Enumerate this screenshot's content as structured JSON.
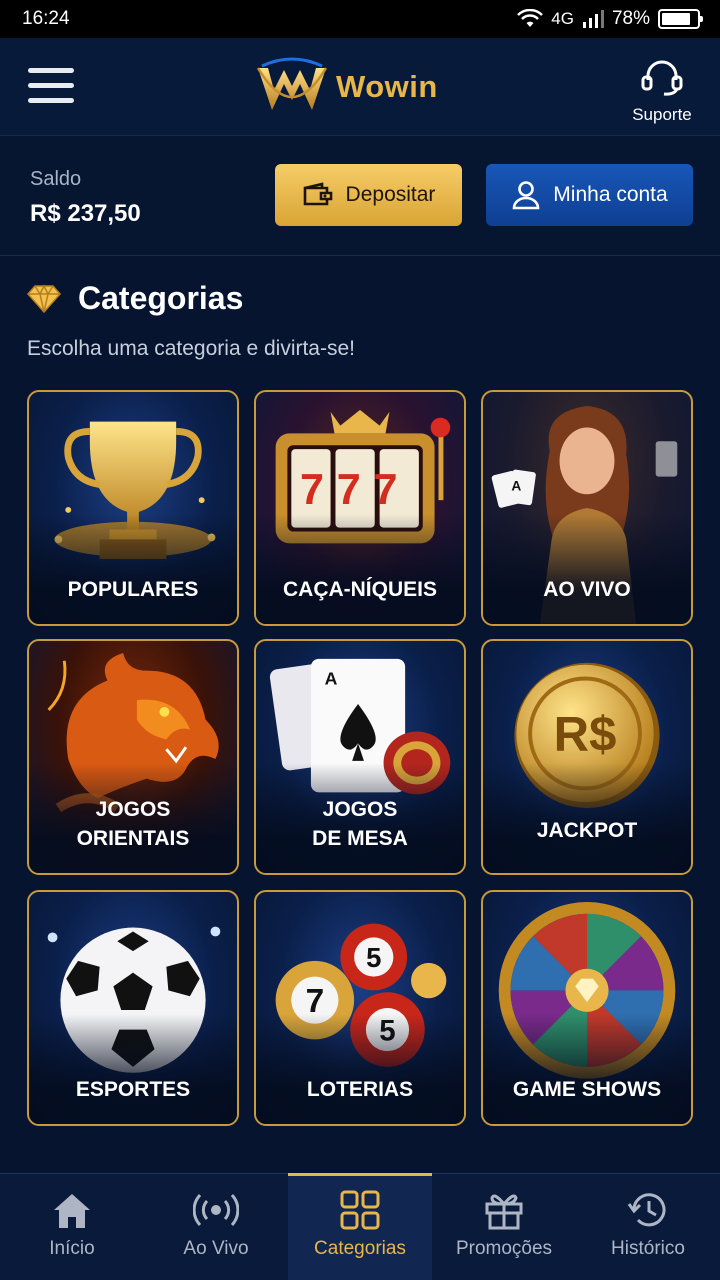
{
  "status_bar": {
    "time": "16:24",
    "network": "4G",
    "battery": "78%"
  },
  "header": {
    "brand": "Wowin",
    "support_label": "Suporte"
  },
  "balance": {
    "label": "Saldo",
    "value": "R$ 237,50",
    "deposit_label": "Depositar",
    "account_label": "Minha conta"
  },
  "categories": {
    "title": "Categorias",
    "subtitle": "Escolha uma categoria e divirta-se!",
    "items": [
      {
        "label": "POPULARES",
        "icon": "trophy-icon"
      },
      {
        "label": "CAÇA-NÍQUEIS",
        "icon": "slot-machine-icon"
      },
      {
        "label": "AO VIVO",
        "icon": "live-dealer-icon"
      },
      {
        "label": "JOGOS\nORIENTAIS",
        "icon": "dragon-icon"
      },
      {
        "label": "JOGOS\nDE MESA",
        "icon": "playing-cards-icon"
      },
      {
        "label": "JACKPOT",
        "icon": "coin-icon"
      },
      {
        "label": "ESPORTES",
        "icon": "soccer-ball-icon"
      },
      {
        "label": "LOTERIAS",
        "icon": "lottery-balls-icon"
      },
      {
        "label": "GAME SHOWS",
        "icon": "prize-wheel-icon"
      }
    ],
    "art_text": {
      "slot": "777",
      "ace": "A",
      "coin": "R$",
      "ball_a": "7",
      "ball_b": "5",
      "ball_c": "5"
    }
  },
  "bottom_nav": [
    {
      "label": "Início",
      "icon": "home-icon"
    },
    {
      "label": "Ao Vivo",
      "icon": "broadcast-icon"
    },
    {
      "label": "Categorias",
      "icon": "grid-icon",
      "active": true
    },
    {
      "label": "Promoções",
      "icon": "gift-icon"
    },
    {
      "label": "Histórico",
      "icon": "history-icon"
    }
  ],
  "colors": {
    "gold": "#e8b64a",
    "navy": "#061430",
    "blue_button": "#1857b8"
  }
}
